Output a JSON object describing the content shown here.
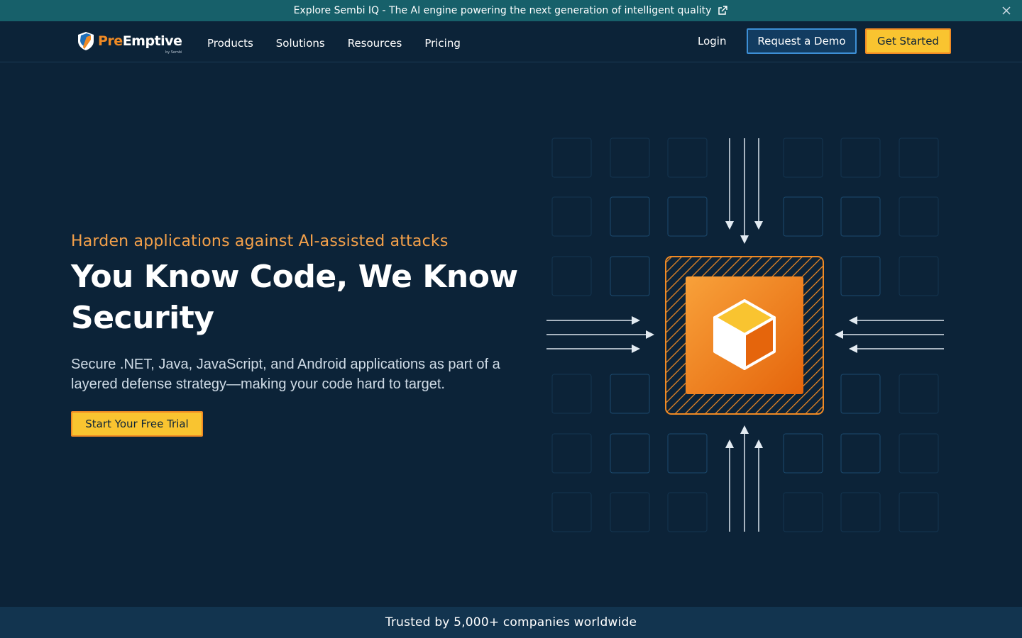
{
  "announcement": {
    "text": "Explore Sembi IQ - The AI engine powering the next generation of intelligent quality",
    "external_icon": "external-link-icon",
    "close_icon": "close-icon"
  },
  "nav": {
    "logo": {
      "pre": "Pre",
      "emptive": "Emptive",
      "by": "by Sembi"
    },
    "menu": [
      "Products",
      "Solutions",
      "Resources",
      "Pricing"
    ],
    "login": "Login",
    "demo_button": "Request a Demo",
    "start_button": "Get Started"
  },
  "hero": {
    "eyebrow": "Harden applications against AI-assisted attacks",
    "headline": "You Know Code, We Know Security",
    "subtext": "Secure .NET, Java, JavaScript, and Android applications as part of a layered defense strategy—making your code hard to target.",
    "cta": "Start Your Free Trial"
  },
  "illustration": {
    "icon": "cube-icon",
    "colors": {
      "accent": "#f08a24",
      "cube_top": "#f9c430",
      "cube_side": "#e5650c",
      "grid": "#1b4566"
    }
  },
  "trusted": {
    "text": "Trusted by 5,000+ companies worldwide"
  },
  "colors": {
    "background": "#0c2338",
    "announcement_bar": "#17606a",
    "primary_button": "#f9c430",
    "secondary_button": "#123c61",
    "eyebrow": "#f5a14a"
  }
}
